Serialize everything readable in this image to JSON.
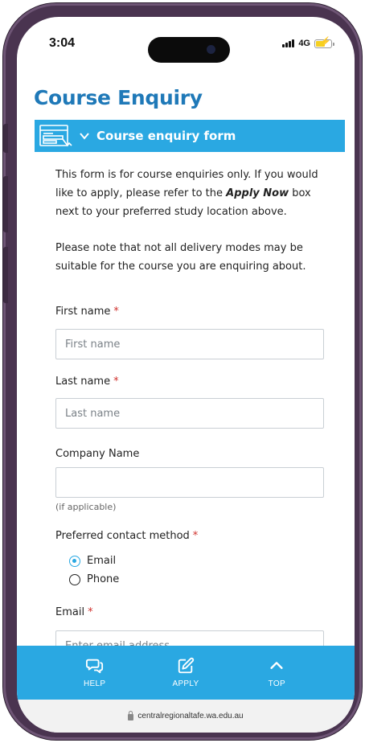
{
  "status_bar": {
    "time": "3:04",
    "network": "4G"
  },
  "page": {
    "title": "Course Enquiry"
  },
  "form_section": {
    "header_label": "Course enquiry form",
    "intro_before": "This form is for course enquiries only. If you would like to apply, please refer to the ",
    "intro_strong": "Apply Now",
    "intro_after": " box next to your preferred study location above.",
    "note": "Please note that not all delivery modes may be suitable for the course you are enquiring about."
  },
  "fields": {
    "first_name": {
      "label": "First name",
      "required_mark": "*",
      "placeholder": "First name",
      "value": ""
    },
    "last_name": {
      "label": "Last name",
      "required_mark": "*",
      "placeholder": "Last name",
      "value": ""
    },
    "company": {
      "label": "Company Name",
      "placeholder": "",
      "value": "",
      "hint": "(if applicable)"
    },
    "contact_method": {
      "label": "Preferred contact method",
      "required_mark": "*",
      "options": [
        {
          "label": "Email",
          "checked": true
        },
        {
          "label": "Phone",
          "checked": false
        }
      ]
    },
    "email": {
      "label": "Email",
      "required_mark": "*",
      "placeholder": "Enter email address",
      "value": ""
    }
  },
  "bottom_nav": {
    "items": [
      {
        "label": "HELP",
        "icon": "chat-icon"
      },
      {
        "label": "APPLY",
        "icon": "edit-icon"
      },
      {
        "label": "TOP",
        "icon": "chevron-up-icon"
      }
    ]
  },
  "browser": {
    "url": "centralregionaltafe.wa.edu.au"
  },
  "colors": {
    "accent": "#2aa8e2",
    "title": "#1f79b8",
    "required": "#d0312d",
    "frame": "#4a3450"
  }
}
